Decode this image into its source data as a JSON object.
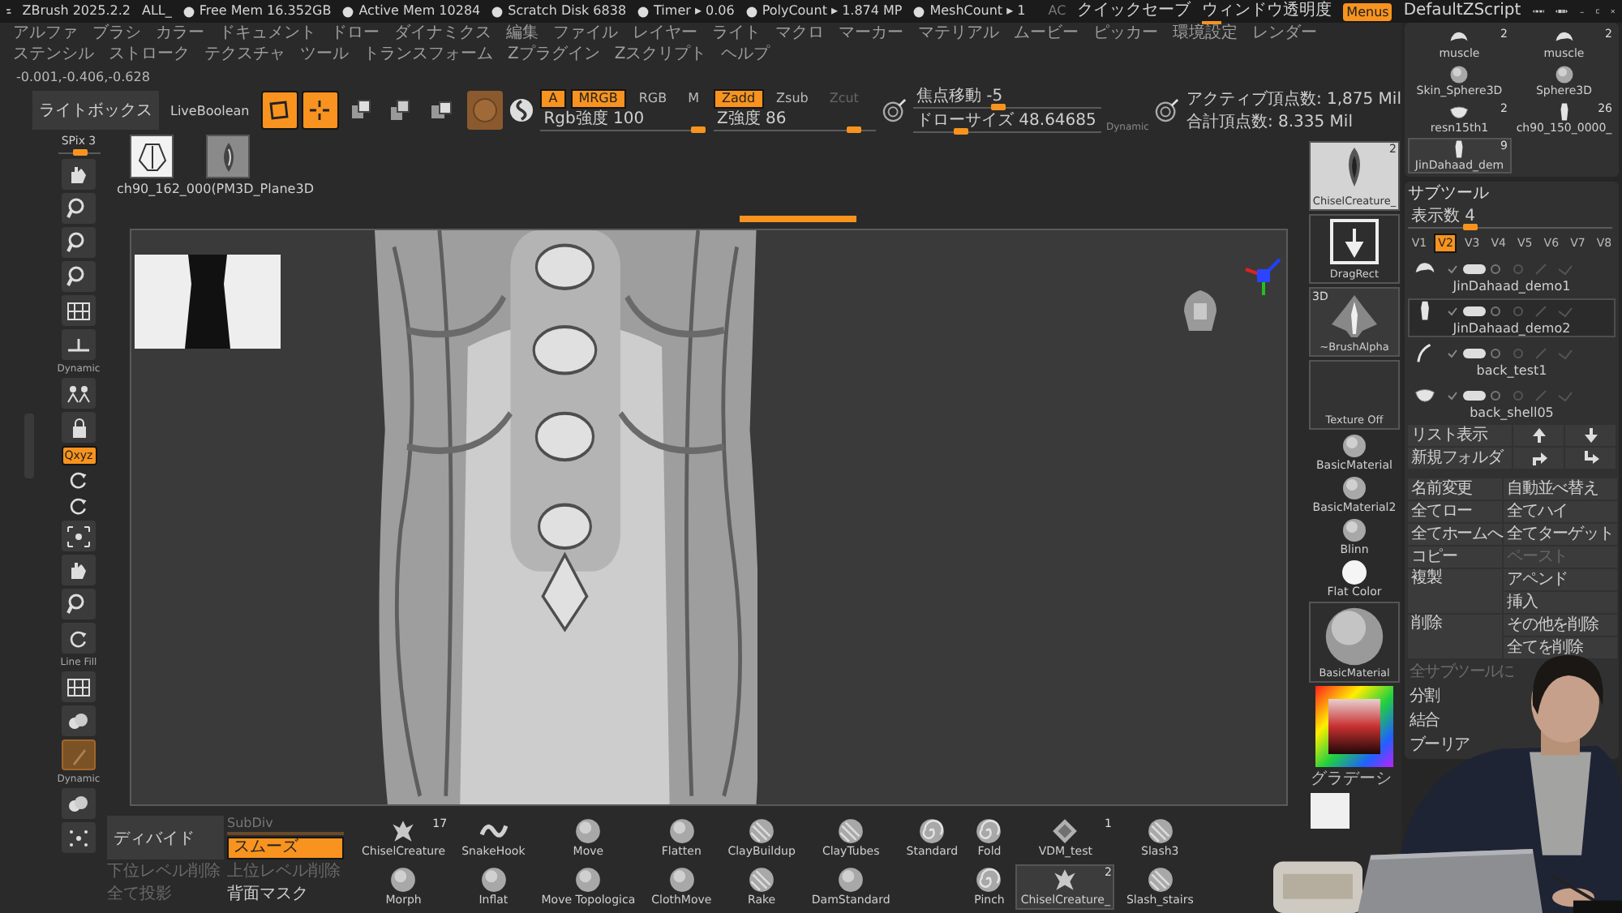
{
  "title_bar": {
    "app": "ZBrush 2025.2.2",
    "layout": "ALL_",
    "stats": [
      "Free Mem 16.352GB",
      "Active Mem 10284",
      "Scratch Disk 6838",
      "Timer ▸ 0.06",
      "PolyCount ▸ 1.874 MP",
      "MeshCount ▸ 1"
    ],
    "right": [
      {
        "kind": "dim",
        "label": "AC"
      },
      {
        "kind": "text",
        "label": "クイックセーブ"
      },
      {
        "kind": "slider",
        "label": "ウィンドウ透明度",
        "level": 0.15
      },
      {
        "kind": "toggle",
        "label": "Menus",
        "on": true
      },
      {
        "kind": "text",
        "label": "DefaultZScript"
      }
    ]
  },
  "menu": [
    "アルファ",
    "ブラシ",
    "カラー",
    "ドキュメント",
    "ドロー",
    "ダイナミクス",
    "編集",
    "ファイル",
    "レイヤー",
    "ライト",
    "マクロ",
    "マーカー",
    "マテリアル",
    "ムービー",
    "ピッカー",
    "環境設定",
    "レンダー",
    "ステンシル",
    "ストローク",
    "テクスチャ",
    "ツール",
    "トランスフォーム",
    "Zプラグイン",
    "Zスクリプト",
    "ヘルプ"
  ],
  "coordinates": "-0.001,-0.406,-0.628",
  "toolbar": {
    "lightbox": "ライトボックス",
    "live_boolean": "LiveBoolean",
    "modes": [
      {
        "kind": "edit",
        "on": true
      },
      {
        "kind": "draw",
        "on": true
      },
      {
        "kind": "move",
        "on": false
      },
      {
        "kind": "scale",
        "on": false
      },
      {
        "kind": "rotate",
        "on": false
      }
    ],
    "channels": [
      {
        "label": "A",
        "on": true
      },
      {
        "label": "MRGB",
        "on": true
      },
      {
        "label": "RGB",
        "on": false
      },
      {
        "label": "M",
        "on": false
      }
    ],
    "rgb_slider": {
      "label": "Rgb強度 100",
      "level": 0.97
    },
    "z_modes": [
      {
        "label": "Zadd",
        "on": true,
        "disabled": false
      },
      {
        "label": "Zsub",
        "on": false,
        "disabled": false
      },
      {
        "label": "Zcut",
        "on": false,
        "disabled": true
      }
    ],
    "z_slider": {
      "label": "Z強度 86",
      "level": 0.86
    },
    "focal_slider": {
      "label": "焦点移動 -5",
      "level": 0.45
    },
    "draw_size_slider": {
      "label": "ドローサイズ 48.64685",
      "level": 0.25
    },
    "dynamic": "Dynamic",
    "stats": [
      "アクティブ頂点数: 1,875 Mil",
      "合計頂点数: 8.335 Mil"
    ]
  },
  "left_shelf": {
    "spix": {
      "label": "SPix 3",
      "level": 0.5
    },
    "items": [
      {
        "kind": "hand",
        "on": false
      },
      {
        "kind": "zoom",
        "on": false
      },
      {
        "kind": "zoom",
        "on": false
      },
      {
        "kind": "zoom",
        "on": false
      },
      {
        "kind": "persp",
        "on": false
      },
      {
        "kind": "floor",
        "on": false
      },
      {
        "kind": "local",
        "caption": "Dynamic",
        "on": false
      },
      {
        "kind": "lock",
        "on": false
      },
      {
        "kind": "toggle",
        "label": "Qxyz",
        "on": true
      },
      {
        "kind": "small-rotate",
        "on": false
      },
      {
        "kind": "small-rotate",
        "on": false
      },
      {
        "kind": "frame",
        "on": false
      },
      {
        "kind": "hand",
        "on": false
      },
      {
        "kind": "zoom",
        "on": false
      },
      {
        "kind": "rotate",
        "on": false
      },
      {
        "kind": "polyf",
        "caption": "Line Fill",
        "on": false
      },
      {
        "kind": "transp",
        "on": false
      },
      {
        "kind": "ghost",
        "on": true
      },
      {
        "kind": "solo",
        "caption": "Dynamic",
        "on": false
      },
      {
        "kind": "dots",
        "on": false
      }
    ]
  },
  "document_thumbnails": {
    "items": [
      {
        "kind": "figure",
        "selected": true
      },
      {
        "kind": "leaf",
        "selected": false
      }
    ],
    "caption": "ch90_162_000(PM3D_Plane3D"
  },
  "right_shelf": [
    {
      "kind": "brush",
      "label": "ChiselCreature_",
      "count": "2"
    },
    {
      "kind": "stroke",
      "label": "DragRect"
    },
    {
      "kind": "alpha",
      "label": "~BrushAlpha",
      "tag": "3D"
    },
    {
      "kind": "texture",
      "label": "Texture Off"
    },
    {
      "kind": "material",
      "label": "BasicMaterial"
    },
    {
      "kind": "material",
      "label": "BasicMaterial2"
    },
    {
      "kind": "material",
      "label": "Blinn"
    },
    {
      "kind": "flat",
      "label": "Flat Color"
    },
    {
      "kind": "big-material",
      "label": "BasicMaterial"
    },
    {
      "kind": "color-picker"
    },
    {
      "kind": "caption",
      "label": "グラデーシ"
    },
    {
      "kind": "swatch"
    }
  ],
  "bottom_shelf": {
    "divide": "ディバイド",
    "subdiv": "SubDiv",
    "smooth": {
      "label": "スムーズ",
      "on": true
    },
    "actions": [
      {
        "label": "下位レベル削除",
        "disabled": true
      },
      {
        "label": "上位レベル削除",
        "disabled": true
      },
      {
        "label": "全て投影",
        "disabled": true
      },
      {
        "label": "背面マスク",
        "disabled": false
      }
    ],
    "brush_columns": [
      [
        {
          "name": "ChiselCreature",
          "count": "17",
          "kind": "creature",
          "selected": false
        },
        {
          "name": "Morph",
          "kind": "sphere",
          "selected": false
        }
      ],
      [
        {
          "name": "SnakeHook",
          "kind": "snake",
          "selected": false
        },
        {
          "name": "Inflat",
          "kind": "sphere",
          "selected": false
        }
      ],
      [
        {
          "name": "Move",
          "kind": "sphere",
          "selected": false
        },
        {
          "name": "Move Topologica",
          "kind": "sphere",
          "selected": false
        }
      ],
      [
        {
          "name": "Flatten",
          "kind": "sphere",
          "selected": false
        },
        {
          "name": "ClothMove",
          "kind": "sphere",
          "selected": false
        }
      ],
      [
        {
          "name": "ClayBuildup",
          "kind": "striped",
          "selected": false
        },
        {
          "name": "Rake",
          "kind": "striped",
          "selected": false
        }
      ],
      [
        {
          "name": "ClayTubes",
          "kind": "striped",
          "selected": false
        },
        {
          "name": "DamStandard",
          "kind": "sphere",
          "selected": false
        }
      ],
      [
        {
          "name": "Standard",
          "kind": "swirl",
          "selected": false
        }
      ],
      [
        {
          "name": "Fold",
          "kind": "swirl",
          "selected": false
        },
        {
          "name": "Pinch",
          "kind": "swirl",
          "selected": false
        }
      ],
      [
        {
          "name": "VDM_test",
          "count": "1",
          "kind": "vdm",
          "selected": false
        },
        {
          "name": "ChiselCreature_",
          "count": "2",
          "kind": "creature",
          "selected": true
        }
      ],
      [
        {
          "name": "Slash3",
          "kind": "striped",
          "selected": false
        },
        {
          "name": "Slash_stairs",
          "kind": "striped",
          "selected": false
        }
      ]
    ]
  },
  "tools": [
    {
      "label": "muscle",
      "count": "2",
      "kind": "muscle",
      "selected": false
    },
    {
      "label": "muscle",
      "count": "2",
      "kind": "muscle",
      "selected": false
    },
    {
      "label": "Skin_Sphere3D",
      "kind": "sphere",
      "selected": false
    },
    {
      "label": "Sphere3D",
      "kind": "sphere",
      "selected": false
    },
    {
      "label": "resn15th1",
      "count": "2",
      "kind": "shell",
      "selected": false
    },
    {
      "label": "ch90_150_0000_",
      "count": "26",
      "kind": "figure",
      "selected": false
    },
    {
      "label": "JinDahaad_dem",
      "count": "9",
      "kind": "figure",
      "selected": true
    }
  ],
  "subtool": {
    "title": "サブツール",
    "visible_count": {
      "label": "表示数 4",
      "level": 0.3
    },
    "versions": [
      {
        "label": "V1",
        "selected": false
      },
      {
        "label": "V2",
        "selected": true
      },
      {
        "label": "V3",
        "selected": false
      },
      {
        "label": "V4",
        "selected": false
      },
      {
        "label": "V5",
        "selected": false
      },
      {
        "label": "V6",
        "selected": false
      },
      {
        "label": "V7",
        "selected": false
      },
      {
        "label": "V8",
        "selected": false
      }
    ],
    "items": [
      {
        "name": "JinDahaad_demo1",
        "kind": "muscle",
        "selected": false
      },
      {
        "name": "JinDahaad_demo2",
        "kind": "figure",
        "selected": true
      },
      {
        "name": "back_test1",
        "kind": "stick",
        "selected": false
      },
      {
        "name": "back_shell05",
        "kind": "shell",
        "selected": false
      }
    ],
    "list_buttons": [
      {
        "kind": "text",
        "label": "リスト表示"
      },
      {
        "kind": "up"
      },
      {
        "kind": "down"
      },
      {
        "kind": "text",
        "label": "新規フォルダ"
      },
      {
        "kind": "turn-right"
      },
      {
        "kind": "turn-down"
      }
    ],
    "actions": [
      {
        "kind": "normal",
        "label": "名前変更",
        "disabled": false
      },
      {
        "kind": "normal",
        "label": "自動並べ替え",
        "disabled": false
      },
      {
        "kind": "normal",
        "label": "全てロー",
        "disabled": false
      },
      {
        "kind": "normal",
        "label": "全てハイ",
        "disabled": false
      },
      {
        "kind": "normal",
        "label": "全てホームへ",
        "disabled": false
      },
      {
        "kind": "normal",
        "label": "全てターゲット",
        "disabled": false
      },
      {
        "kind": "normal",
        "label": "コピー",
        "disabled": false
      },
      {
        "kind": "normal",
        "label": "ペースト",
        "disabled": true
      },
      {
        "kind": "tall",
        "label": "複製",
        "disabled": false
      },
      {
        "kind": "normal",
        "label": "アペンド",
        "disabled": false
      },
      {
        "kind": "normal",
        "label": "挿入",
        "disabled": false
      },
      {
        "kind": "tall",
        "label": "削除",
        "disabled": false
      },
      {
        "kind": "normal",
        "label": "その他を削除",
        "disabled": false
      },
      {
        "kind": "normal",
        "label": "全てを削除",
        "disabled": false
      }
    ],
    "sections": [
      {
        "label": "全サブツールに",
        "disabled": true
      },
      {
        "label": "分割",
        "disabled": false
      },
      {
        "label": "結合",
        "disabled": false
      },
      {
        "label": "ブーリア",
        "disabled": false
      }
    ]
  }
}
